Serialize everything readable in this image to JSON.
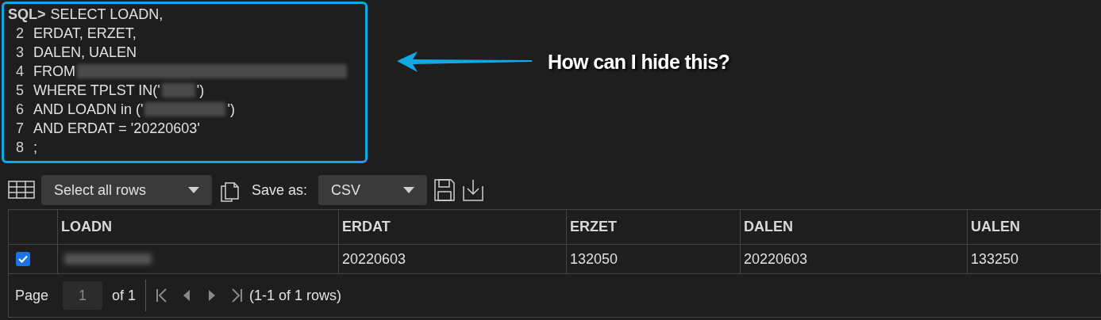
{
  "sql": {
    "prompt": "SQL>",
    "lines": [
      {
        "segments": [
          {
            "kind": "text",
            "text": "SELECT LOADN,"
          }
        ]
      },
      {
        "number": "2",
        "segments": [
          {
            "kind": "text",
            "text": "ERDAT, ERZET,"
          }
        ]
      },
      {
        "number": "3",
        "segments": [
          {
            "kind": "text",
            "text": "DALEN, UALEN"
          }
        ]
      },
      {
        "number": "4",
        "segments": [
          {
            "kind": "text",
            "text": "FROM"
          },
          {
            "kind": "redacted"
          }
        ]
      },
      {
        "number": "5",
        "segments": [
          {
            "kind": "text",
            "text": "WHERE TPLST IN('"
          },
          {
            "kind": "redacted"
          },
          {
            "kind": "text",
            "text": "')"
          }
        ]
      },
      {
        "number": "6",
        "segments": [
          {
            "kind": "text",
            "text": "AND LOADN in ('"
          },
          {
            "kind": "redacted"
          },
          {
            "kind": "text",
            "text": "')"
          }
        ]
      },
      {
        "number": "7",
        "segments": [
          {
            "kind": "text",
            "text": "AND ERDAT = '20220603'"
          }
        ]
      },
      {
        "number": "8",
        "segments": [
          {
            "kind": "text",
            "text": ";"
          }
        ]
      }
    ]
  },
  "annotation": {
    "text": "How can I hide this?"
  },
  "toolbar": {
    "select_rows": "Select all rows",
    "save_as_label": "Save as:",
    "format": "CSV"
  },
  "table": {
    "columns": [
      "LOADN",
      "ERDAT",
      "ERZET",
      "DALEN",
      "UALEN"
    ],
    "rows": [
      {
        "checked": true,
        "cells": [
          {
            "kind": "redacted"
          },
          {
            "kind": "text",
            "text": "20220603"
          },
          {
            "kind": "text",
            "text": "132050"
          },
          {
            "kind": "text",
            "text": "20220603"
          },
          {
            "kind": "text",
            "text": "133250"
          }
        ]
      }
    ]
  },
  "pager": {
    "page_label": "Page",
    "page_value": "1",
    "of_label": "of 1",
    "summary": "(1-1 of 1 rows)"
  }
}
